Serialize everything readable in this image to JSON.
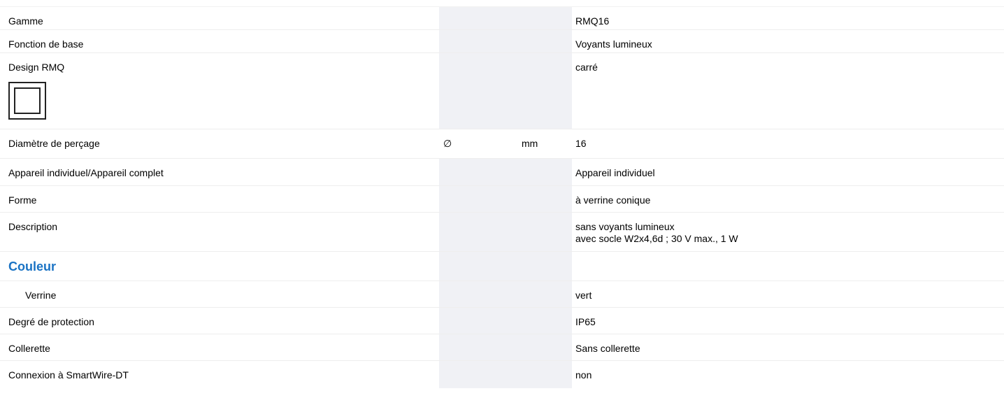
{
  "rows": [
    {
      "label": "Gamme",
      "symbol": "",
      "unit": "",
      "value": "RMQ16"
    },
    {
      "label": "Fonction de base",
      "symbol": "",
      "unit": "",
      "value": "Voyants lumineux"
    },
    {
      "label": "Design RMQ",
      "symbol": "",
      "unit": "",
      "value": "carré"
    },
    {
      "label": "Diamètre de perçage",
      "symbol": "∅",
      "unit": "mm",
      "value": "16"
    },
    {
      "label": "Appareil individuel/Appareil complet",
      "symbol": "",
      "unit": "",
      "value": "Appareil individuel"
    },
    {
      "label": "Forme",
      "symbol": "",
      "unit": "",
      "value": "à verrine conique"
    },
    {
      "label": "Description",
      "symbol": "",
      "unit": "",
      "value_line1": "sans voyants lumineux",
      "value_line2": "avec socle W2x4,6d ; 30 V max., 1 W"
    },
    {
      "section_title": "Couleur"
    },
    {
      "label": "Verrine",
      "symbol": "",
      "unit": "",
      "value": "vert"
    },
    {
      "label": "Degré de protection",
      "symbol": "",
      "unit": "",
      "value": "IP65"
    },
    {
      "label": "Collerette",
      "symbol": "",
      "unit": "",
      "value": "Sans collerette"
    },
    {
      "label": "Connexion à SmartWire-DT",
      "symbol": "",
      "unit": "",
      "value": "non"
    }
  ],
  "colors": {
    "accent": "#1a73c4",
    "gray_column": "#f0f1f5",
    "divider": "#eeeeee"
  },
  "icons": {
    "design": "square-frame-icon"
  }
}
